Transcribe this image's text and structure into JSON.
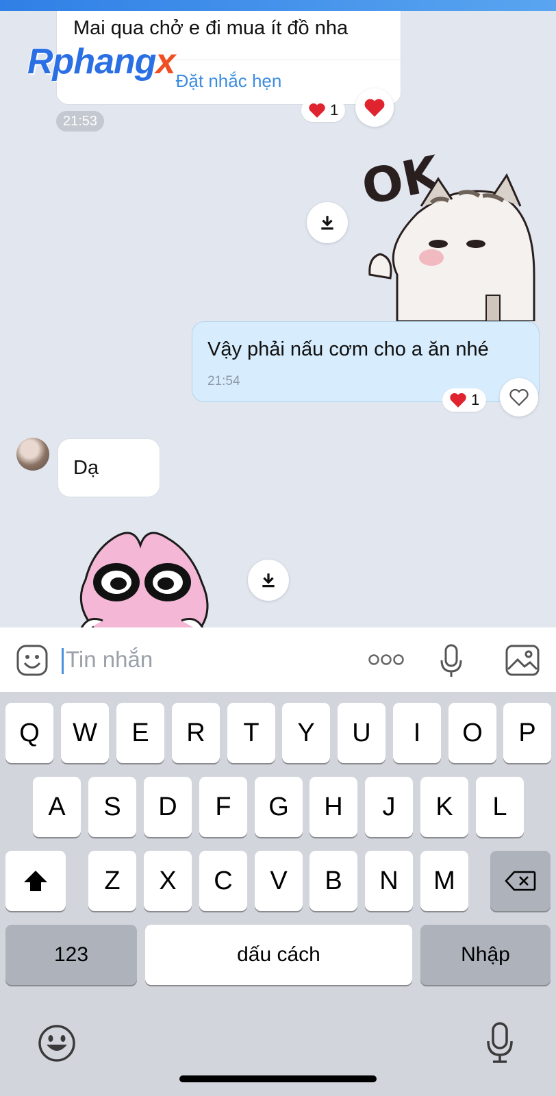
{
  "chat": {
    "msg1": {
      "text": "Mai qua chở e đi mua ít đồ nha",
      "action": "Đặt nhắc hẹn",
      "time": "21:53",
      "reaction_count": "1"
    },
    "watermark": {
      "part1": "Rphang",
      "part2": "x"
    },
    "sticker_ok": {
      "text": "OK"
    },
    "msg2": {
      "text": "Vậy phải nấu cơm cho a ăn nhé",
      "time": "21:54",
      "reaction_count": "1"
    },
    "msg3": {
      "text": "Dạ"
    }
  },
  "input": {
    "placeholder": "Tin nhắn",
    "icons": [
      "sticker-icon",
      "more-icon",
      "microphone-icon",
      "image-icon"
    ]
  },
  "keyboard": {
    "row1": [
      "Q",
      "W",
      "E",
      "R",
      "T",
      "Y",
      "U",
      "I",
      "O",
      "P"
    ],
    "row2": [
      "A",
      "S",
      "D",
      "F",
      "G",
      "H",
      "J",
      "K",
      "L"
    ],
    "row3": [
      "Z",
      "X",
      "C",
      "V",
      "B",
      "N",
      "M"
    ],
    "numbers": "123",
    "space": "dấu cách",
    "return": "Nhập"
  },
  "colors": {
    "accent": "#3d8ce0",
    "outgoing_bubble": "#d7ecfc",
    "chat_bg": "#e1e6ef",
    "heart": "#e0242f"
  }
}
